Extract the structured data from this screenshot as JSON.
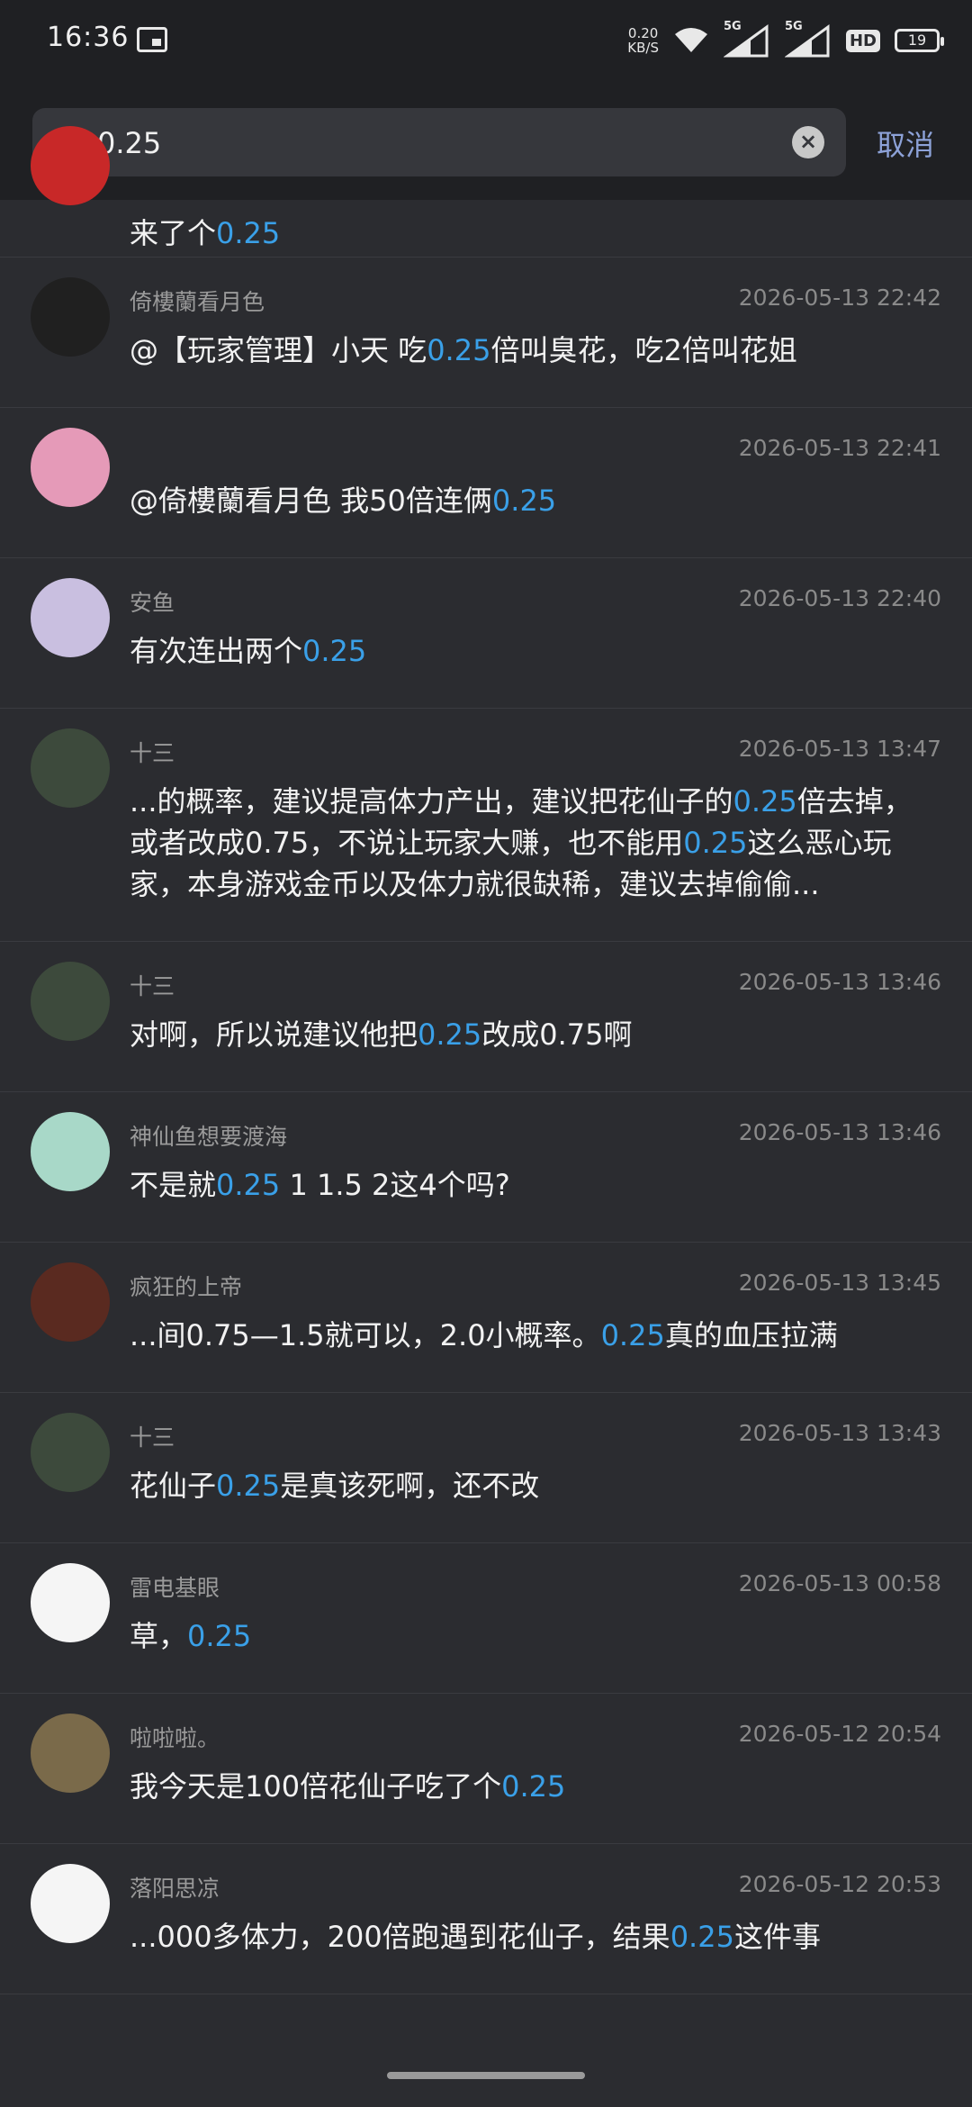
{
  "status_bar": {
    "time": "16:36",
    "net_speed_value": "0.20",
    "net_speed_unit": "KB/S",
    "sim1_label": "5G",
    "sim2_label": "5G",
    "hd_label": "HD",
    "battery": "19"
  },
  "search": {
    "query": "0.25",
    "cancel_label": "取消"
  },
  "results": [
    {
      "name": "",
      "date": "",
      "pre": "来了个",
      "hl": "0.25",
      "post": "",
      "avatar_color": "#c82828"
    },
    {
      "name": "倚樓蘭看月色",
      "date": "2026-05-13 22:42",
      "pre": "@【玩家管理】小天  吃",
      "hl": "0.25",
      "post": "倍叫臭花，吃2倍叫花姐",
      "avatar_color": "#202020"
    },
    {
      "name": "",
      "date": "2026-05-13 22:41",
      "pre": "@倚樓蘭看月色  我50倍连俩",
      "hl": "0.25",
      "post": "",
      "avatar_color": "#e59ab8"
    },
    {
      "name": "安鱼",
      "date": "2026-05-13 22:40",
      "pre": "有次连出两个",
      "hl": "0.25",
      "post": "",
      "avatar_color": "#c9bfe0"
    },
    {
      "name": "十三",
      "date": "2026-05-13 13:47",
      "pre": "...的概率，建议提高体力产出，建议把花仙子的",
      "hl": "0.25",
      "post": "倍去掉，或者改成0.75，不说让玩家大赚，也不能用",
      "hl2": "0.25",
      "post2": "这么恶心玩家，本身游戏金币以及体力就很缺稀，建议去掉偷偷...",
      "avatar_color": "#3d4a3c"
    },
    {
      "name": "十三",
      "date": "2026-05-13 13:46",
      "pre": "对啊，所以说建议他把",
      "hl": "0.25",
      "post": "改成0.75啊",
      "avatar_color": "#3d4a3c"
    },
    {
      "name": "神仙鱼想要渡海",
      "date": "2026-05-13 13:46",
      "pre": "不是就",
      "hl": "0.25",
      "post": " 1 1.5 2这4个吗?",
      "avatar_color": "#a8d8c8"
    },
    {
      "name": "疯狂的上帝",
      "date": "2026-05-13 13:45",
      "pre": "...间0.75—1.5就可以，2.0小概率。",
      "hl": "0.25",
      "post": "真的血压拉满",
      "avatar_color": "#5a2a20"
    },
    {
      "name": "十三",
      "date": "2026-05-13 13:43",
      "pre": "花仙子",
      "hl": "0.25",
      "post": "是真该死啊，还不改",
      "avatar_color": "#3d4a3c"
    },
    {
      "name": "雷电基眼",
      "date": "2026-05-13 00:58",
      "pre": "草，",
      "hl": "0.25",
      "post": "",
      "avatar_color": "#f5f5f5"
    },
    {
      "name": "啦啦啦。",
      "date": "2026-05-12 20:54",
      "pre": "我今天是100倍花仙子吃了个",
      "hl": "0.25",
      "post": "",
      "avatar_color": "#7a6a4a"
    },
    {
      "name": "落阳思凉",
      "date": "2026-05-12 20:53",
      "pre": "...000多体力，200倍跑遇到花仙子，结果",
      "hl": "0.25",
      "post": "这件事",
      "avatar_color": "#f5f5f5"
    }
  ]
}
